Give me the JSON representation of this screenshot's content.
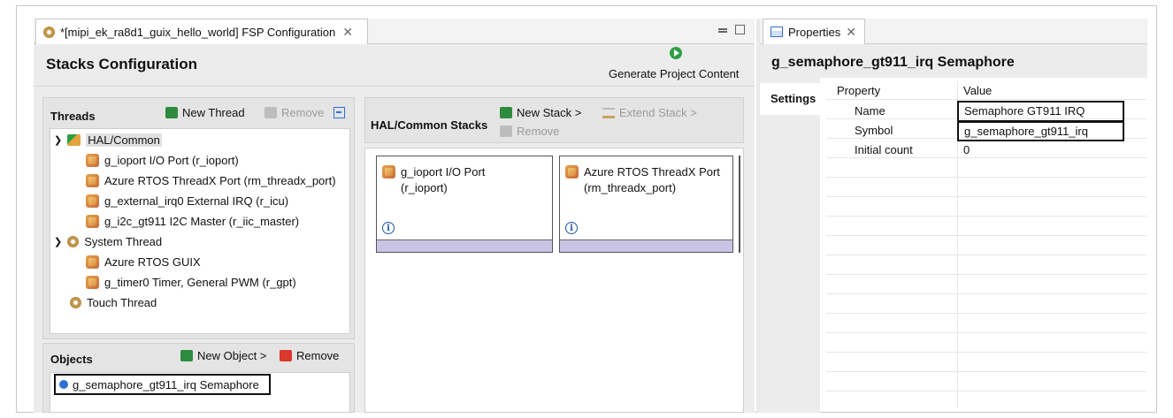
{
  "editor": {
    "tab_title": "*[mipi_ek_ra8d1_guix_hello_world] FSP Configuration",
    "header_title": "Stacks Configuration",
    "generate_label": "Generate Project Content"
  },
  "threads": {
    "title": "Threads",
    "new_thread": "New Thread",
    "remove": "Remove",
    "items": [
      {
        "label": "HAL/Common"
      },
      {
        "label": "g_ioport I/O Port (r_ioport)"
      },
      {
        "label": "Azure RTOS ThreadX Port (rm_threadx_port)"
      },
      {
        "label": "g_external_irq0 External IRQ (r_icu)"
      },
      {
        "label": "g_i2c_gt911 I2C Master (r_iic_master)"
      },
      {
        "label": "System Thread"
      },
      {
        "label": "Azure RTOS GUIX"
      },
      {
        "label": "g_timer0 Timer, General PWM (r_gpt)"
      },
      {
        "label": "Touch Thread"
      }
    ]
  },
  "objects": {
    "title": "Objects",
    "new_object": "New Object >",
    "remove": "Remove",
    "items": [
      {
        "label": "g_semaphore_gt911_irq Semaphore"
      }
    ]
  },
  "stacks": {
    "title": "HAL/Common Stacks",
    "new_stack": "New Stack >",
    "extend_stack": "Extend Stack >",
    "remove": "Remove",
    "cards": [
      {
        "line1": "g_ioport I/O Port",
        "line2": "(r_ioport)",
        "info": "i"
      },
      {
        "line1": "Azure RTOS ThreadX Port",
        "line2": "(rm_threadx_port)",
        "info": "i"
      }
    ]
  },
  "properties": {
    "tab_title": "Properties",
    "heading": "g_semaphore_gt911_irq Semaphore",
    "settings_tab": "Settings",
    "col_property": "Property",
    "col_value": "Value",
    "rows": [
      {
        "property": "Name",
        "value": "Semaphore GT911 IRQ"
      },
      {
        "property": "Symbol",
        "value": "g_semaphore_gt911_irq"
      },
      {
        "property": "Initial count",
        "value": "0"
      }
    ]
  },
  "colors": {
    "accent_blue": "#2f6fd6",
    "generate_green": "#2e9e44",
    "card_footer": "#c9c4e6"
  }
}
